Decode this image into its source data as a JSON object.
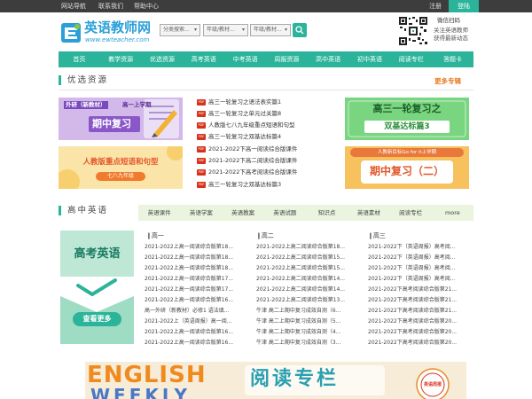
{
  "topbar": {
    "links": [
      "网站导航",
      "联系我们",
      "帮助中心"
    ],
    "register": "注册",
    "login": "登陆"
  },
  "logo": {
    "cn": "英语教师网",
    "en": "www.ewteacher.com"
  },
  "search": {
    "select1": "分类搜索...",
    "select2": "年级/教材...",
    "select3": "年级/教材..."
  },
  "wechat": {
    "title": "微信扫码",
    "line1": "关注英语教师",
    "line2": "获得最新动态"
  },
  "nav": [
    "首页",
    "教学资源",
    "优选资源",
    "高考英语",
    "中考英语",
    "周报资源",
    "高中英语",
    "初中英语",
    "阅读专栏",
    "答题卡"
  ],
  "featured": {
    "title": "优选资源",
    "more": "更多专辑",
    "banners": {
      "b1_tag": "外研（新教材）",
      "b1_sub": "高一上学期",
      "b1_main": "期中复习",
      "b2_main": "人教版重点短语和句型",
      "b2_sub": "七八九年级",
      "b3_main": "高三一轮复习之",
      "b3_sub": "双基达标篇3",
      "b4_tag": "人教新目标Go for it上学期",
      "b4_main": "期中复习（二）"
    },
    "pdf_label": "PDF",
    "items": [
      "高三一轮复习之语法表实篇1",
      "高三一轮复习之单元过关篇8",
      "人教版七八九年级重点短语和句型",
      "高三一轮复习之双基达标篇4",
      "2021-2022下高一阅读综合版课件",
      "2021-2022下高二阅读综合版课件",
      "2021-2022下高考阅读综合版课件",
      "高三一轮复习之双基达标篇3"
    ]
  },
  "highschool": {
    "title": "高中英语",
    "tabs": [
      "英语课件",
      "英语学案",
      "英语教案",
      "英语试题",
      "知识点",
      "英语素材",
      "阅读专栏",
      "more"
    ],
    "ad": {
      "title": "高考英语",
      "btn": "查看更多"
    },
    "columns": [
      {
        "head": "高一",
        "items": [
          "2021-2022上高一阅读综合版第18...",
          "2021-2022上高一阅读综合版第18...",
          "2021-2022上高一阅读综合版第18...",
          "2021-2022上高一阅读综合版第17...",
          "2021-2022上高一阅读综合版第17...",
          "2021-2022上高一阅读综合版第16...",
          "高一外研（新教材）必修1 语法填...",
          "2021-2022上（英语周报）高一阅...",
          "2021-2022上高一阅读综合版第16...",
          "2021-2022上高一阅读综合版第16..."
        ]
      },
      {
        "head": "高二",
        "items": [
          "2021-2022上高二阅读综合版第18...",
          "2021-2022上高二阅读综合版第15...",
          "2021-2022上高二阅读综合版第15...",
          "2021-2022上高二阅读综合版第14...",
          "2021-2022上高二阅读综合版第14...",
          "2021-2022上高二阅读综合版第13...",
          "牛津 高二上期中复习成效自测（6...",
          "牛津 高二上期中复习成效自测（5...",
          "牛津 高二上期中复习成效自测（4...",
          "牛津 高二上期中复习成效自测（3..."
        ]
      },
      {
        "head": "高三",
        "items": [
          "2021-2022下（英语周报）高考阅...",
          "2021-2022下（英语周报）高考阅...",
          "2021-2022下（英语周报）高考阅...",
          "2021-2022下（英语周报）高考阅...",
          "2021-2022下高考阅读综合版第21...",
          "2021-2022下高考阅读综合版第21...",
          "2021-2022下高考阅读综合版第21...",
          "2021-2022下高考阅读综合版第20...",
          "2021-2022下高考阅读综合版第20...",
          "2021-2022下高考阅读综合版第20..."
        ]
      }
    ]
  },
  "bottom_banner": {
    "english": "ENGLISH",
    "weekly": "WEEKLY",
    "cn": "阅读专栏",
    "seal": "英语周报"
  }
}
